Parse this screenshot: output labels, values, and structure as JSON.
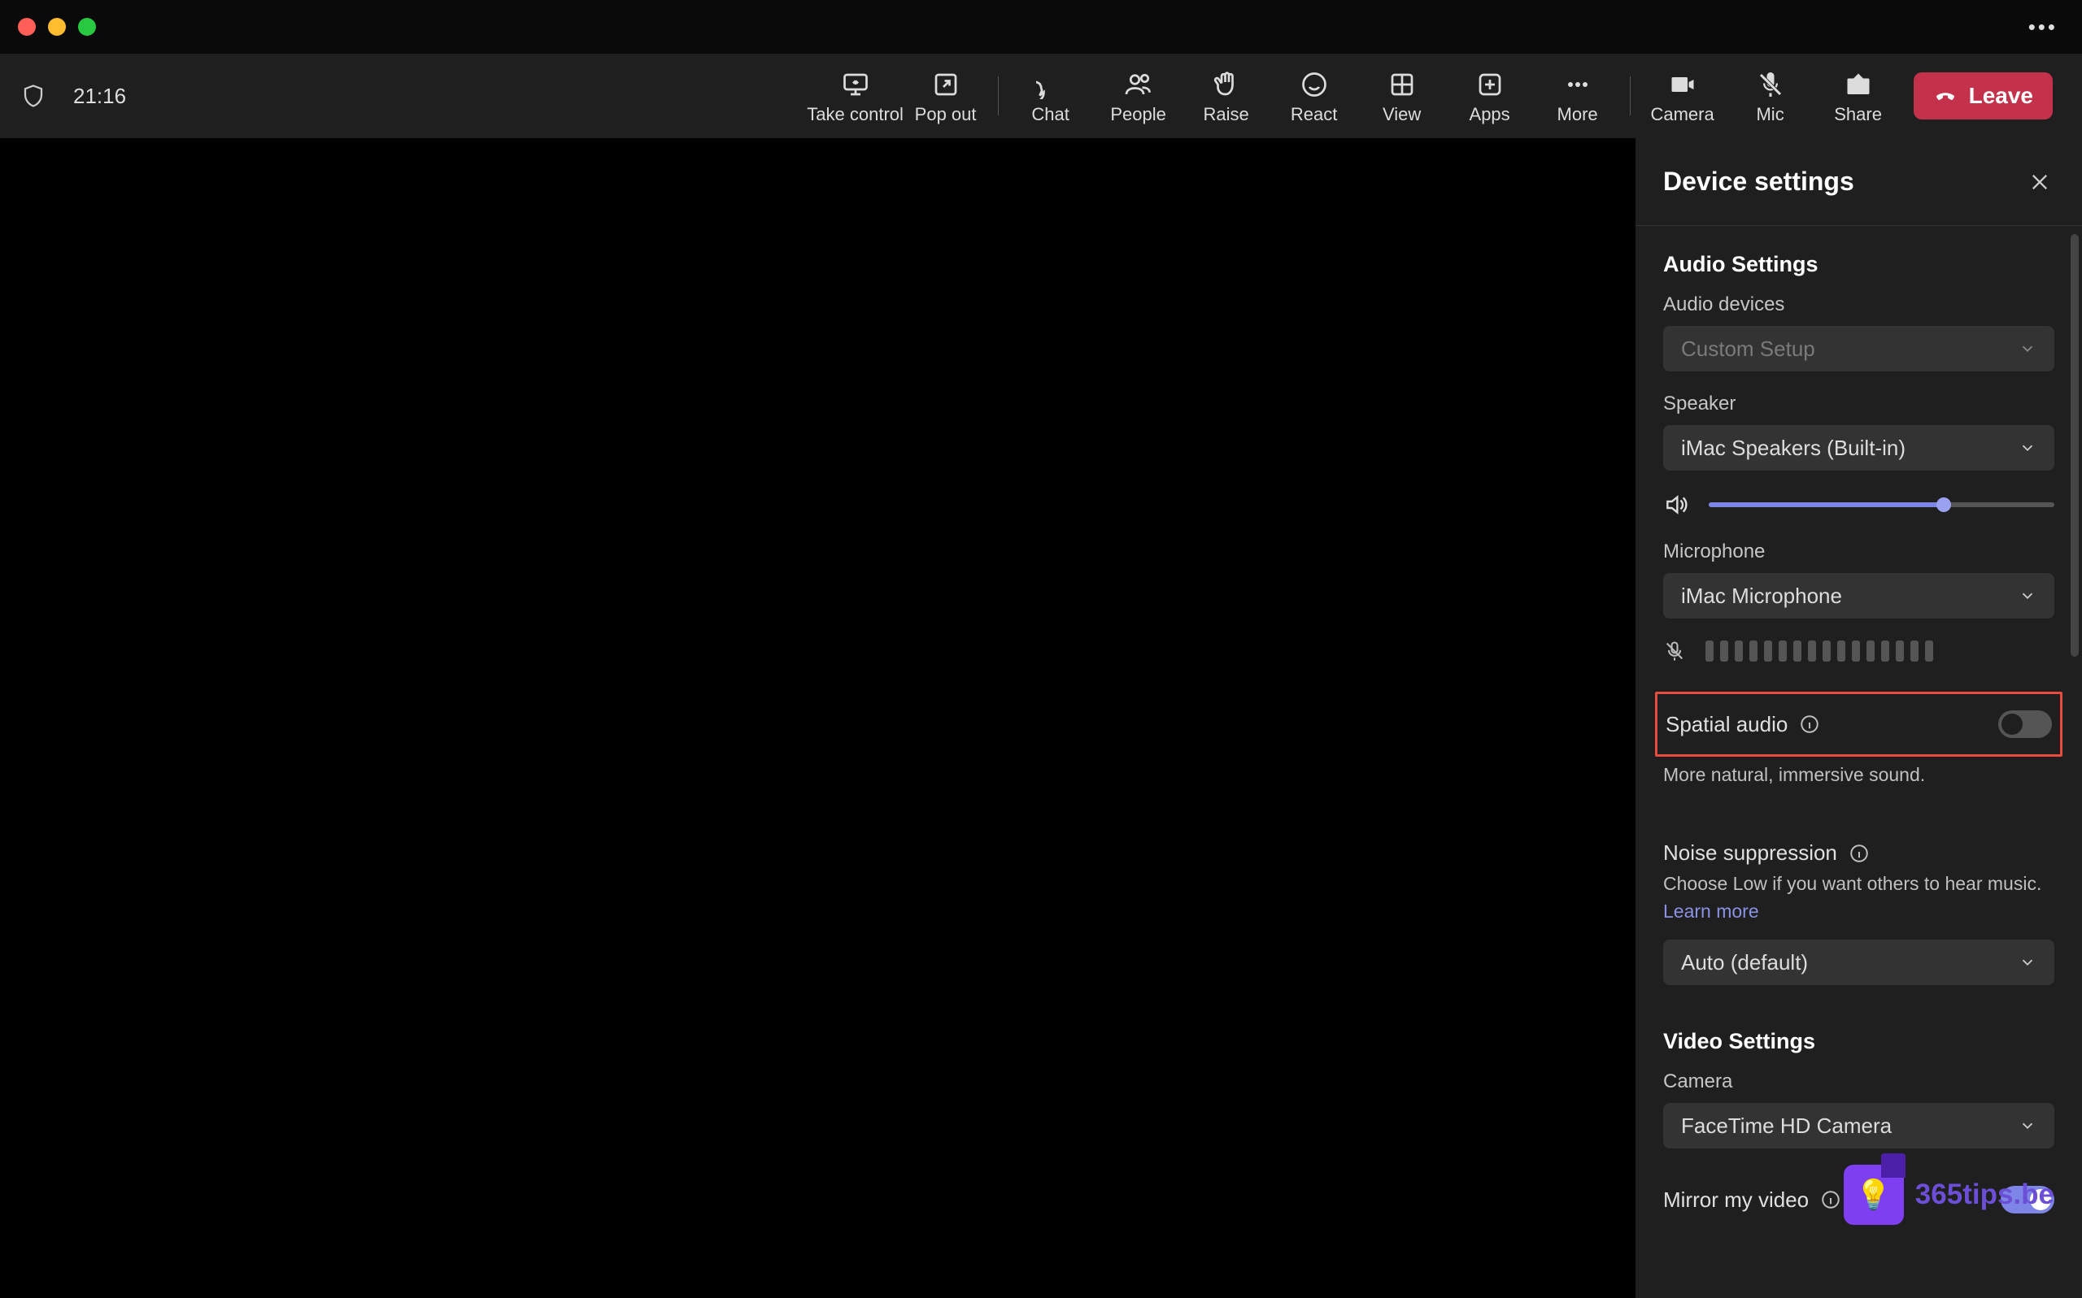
{
  "titlebar": {
    "more_tooltip": "More"
  },
  "toolbar": {
    "time": "21:16",
    "take_control": "Take control",
    "pop_out": "Pop out",
    "chat": "Chat",
    "people": "People",
    "raise": "Raise",
    "react": "React",
    "view": "View",
    "apps": "Apps",
    "more": "More",
    "camera": "Camera",
    "mic": "Mic",
    "share": "Share",
    "leave": "Leave"
  },
  "panel": {
    "title": "Device settings",
    "audio": {
      "section": "Audio Settings",
      "devices_label": "Audio devices",
      "devices_value": "Custom Setup",
      "speaker_label": "Speaker",
      "speaker_value": "iMac Speakers (Built-in)",
      "speaker_volume_pct": 68,
      "mic_label": "Microphone",
      "mic_value": "iMac Microphone",
      "mic_level_bars": 16,
      "spatial_label": "Spatial audio",
      "spatial_on": false,
      "spatial_desc": "More natural, immersive sound.",
      "noise_label": "Noise suppression",
      "noise_desc_pre": "Choose Low if you want others to hear music. ",
      "noise_desc_link": "Learn more",
      "noise_value": "Auto (default)"
    },
    "video": {
      "section": "Video Settings",
      "camera_label": "Camera",
      "camera_value": "FaceTime HD Camera",
      "mirror_label": "Mirror my video",
      "mirror_on": true
    }
  },
  "watermark": {
    "text": "365tips.be"
  }
}
